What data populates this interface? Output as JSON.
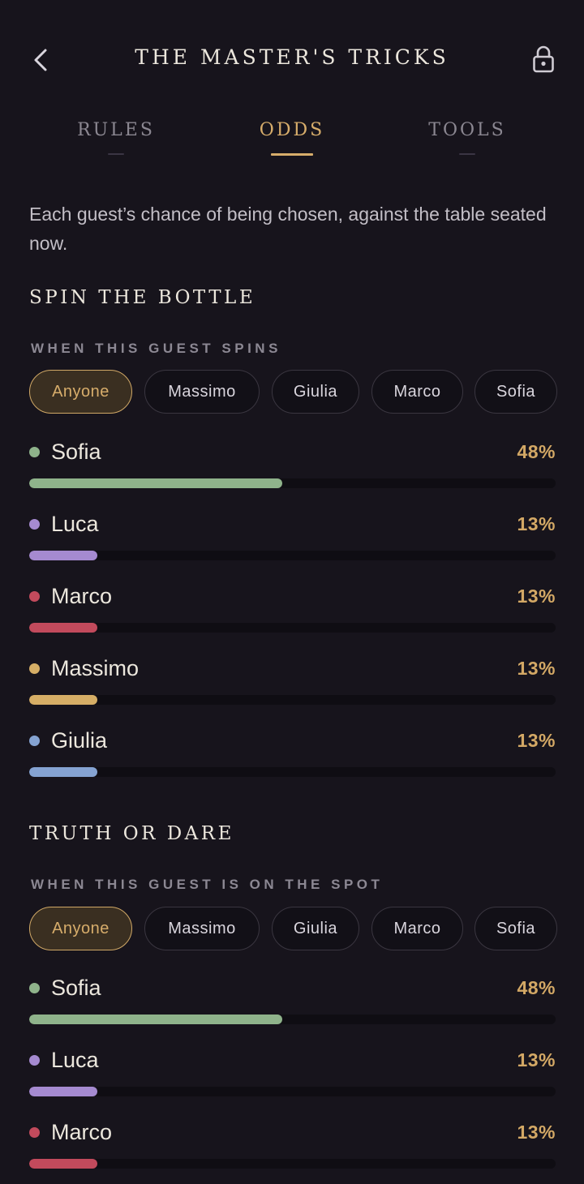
{
  "header": {
    "title": "THE MASTER'S TRICKS",
    "back_icon": "chevron-left-icon",
    "lock_icon": "lock-icon"
  },
  "tabs": [
    {
      "label": "RULES",
      "active": false
    },
    {
      "label": "ODDS",
      "active": true
    },
    {
      "label": "TOOLS",
      "active": false
    }
  ],
  "intro": "Each guest’s chance of being chosen, against the table seated now.",
  "sections": [
    {
      "title": "SPIN THE BOTTLE",
      "subtitle": "WHEN THIS GUEST SPINS",
      "chips": [
        {
          "label": "Anyone",
          "active": true
        },
        {
          "label": "Massimo",
          "active": false
        },
        {
          "label": "Giulia",
          "active": false
        },
        {
          "label": "Marco",
          "active": false
        },
        {
          "label": "Sofia",
          "active": false
        }
      ],
      "rows": [
        {
          "name": "Sofia",
          "percent_label": "48%",
          "value": 48,
          "color": "#8fb38b"
        },
        {
          "name": "Luca",
          "percent_label": "13%",
          "value": 13,
          "color": "#a58ad0"
        },
        {
          "name": "Marco",
          "percent_label": "13%",
          "value": 13,
          "color": "#c24a5c"
        },
        {
          "name": "Massimo",
          "percent_label": "13%",
          "value": 13,
          "color": "#d6ae66"
        },
        {
          "name": "Giulia",
          "percent_label": "13%",
          "value": 13,
          "color": "#85a3d2"
        }
      ]
    },
    {
      "title": "TRUTH OR DARE",
      "subtitle": "WHEN THIS GUEST IS ON THE SPOT",
      "chips": [
        {
          "label": "Anyone",
          "active": true
        },
        {
          "label": "Massimo",
          "active": false
        },
        {
          "label": "Giulia",
          "active": false
        },
        {
          "label": "Marco",
          "active": false
        },
        {
          "label": "Sofia",
          "active": false
        }
      ],
      "rows": [
        {
          "name": "Sofia",
          "percent_label": "48%",
          "value": 48,
          "color": "#8fb38b"
        },
        {
          "name": "Luca",
          "percent_label": "13%",
          "value": 13,
          "color": "#a58ad0"
        },
        {
          "name": "Marco",
          "percent_label": "13%",
          "value": 13,
          "color": "#c24a5c"
        }
      ]
    }
  ]
}
